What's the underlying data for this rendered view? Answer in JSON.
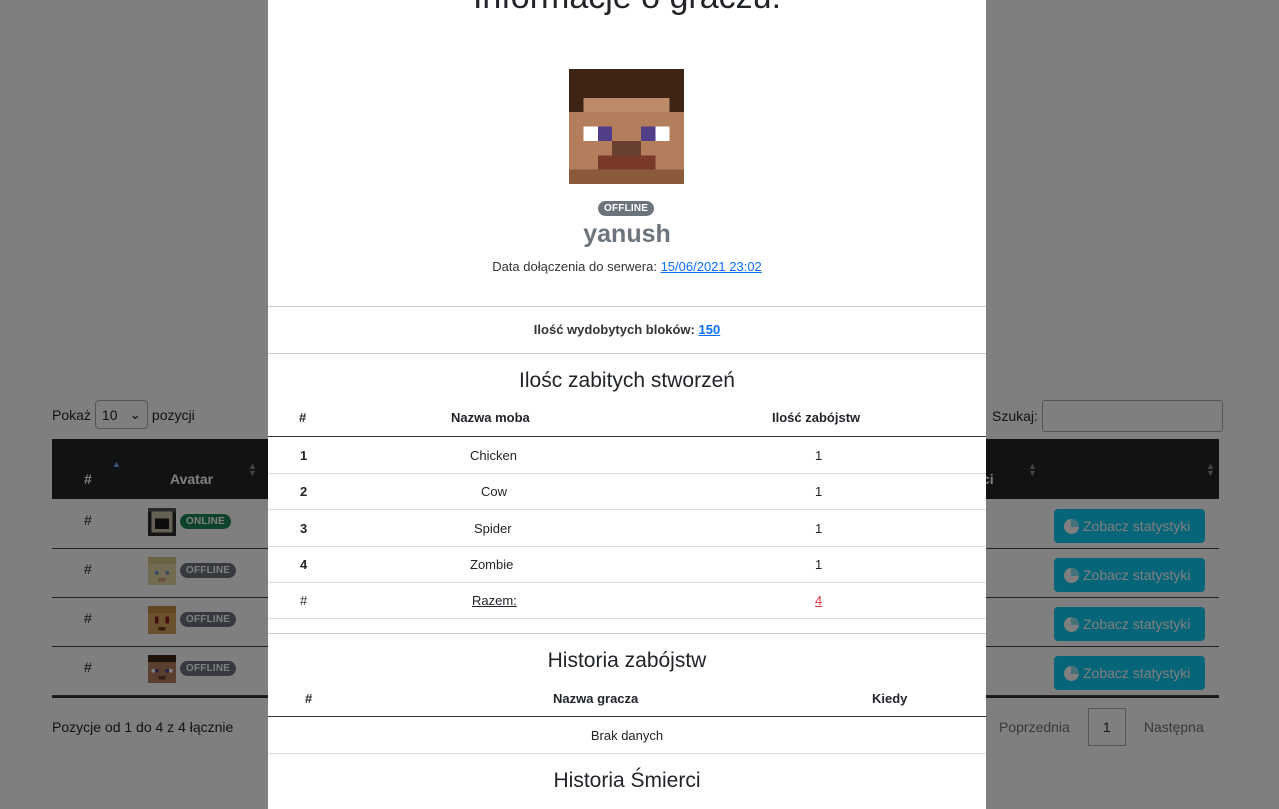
{
  "background": {
    "length": {
      "prefix": "Pokaż",
      "value": "10",
      "suffix": "pozycji"
    },
    "search_label": "Szukaj:",
    "columns": {
      "hash": "#",
      "avatar": "Avatar",
      "partial": "ci"
    },
    "rows": [
      {
        "hash": "#",
        "status": "ONLINE"
      },
      {
        "hash": "#",
        "status": "OFFLINE"
      },
      {
        "hash": "#",
        "status": "OFFLINE"
      },
      {
        "hash": "#",
        "status": "OFFLINE"
      }
    ],
    "stats_button_label": "Zobacz statystyki",
    "info": "Pozycje od 1 do 4 z 4 łącznie",
    "pager": {
      "prev": "Poprzednia",
      "current": "1",
      "next": "Następna"
    }
  },
  "modal": {
    "title": "Informacje o graczu:",
    "status": "OFFLINE",
    "player_name": "yanush",
    "joined_label": "Data dołączenia do serwera:",
    "joined_value": "15/06/2021 23:02",
    "blocks_label": "Ilość wydobytych bloków:",
    "blocks_value": "150",
    "kills": {
      "title": "Ilośc zabitych stworzeń",
      "headers": {
        "hash": "#",
        "mob": "Nazwa moba",
        "count": "Ilość zabójstw"
      },
      "rows": [
        {
          "n": "1",
          "mob": "Chicken",
          "count": "1"
        },
        {
          "n": "2",
          "mob": "Cow",
          "count": "1"
        },
        {
          "n": "3",
          "mob": "Spider",
          "count": "1"
        },
        {
          "n": "4",
          "mob": "Zombie",
          "count": "1"
        }
      ],
      "total": {
        "n": "#",
        "label": "Razem:",
        "count": "4"
      }
    },
    "kill_history": {
      "title": "Historia zabójstw",
      "headers": {
        "hash": "#",
        "player": "Nazwa gracza",
        "when": "Kiedy"
      },
      "empty": "Brak danych"
    },
    "death_history": {
      "title": "Historia Śmierci"
    }
  },
  "colors": {
    "online": "#198754",
    "offline": "#6c757d",
    "stats_button": "#0dcaf0",
    "link": "#0d6efd",
    "total": "#dc3545"
  }
}
